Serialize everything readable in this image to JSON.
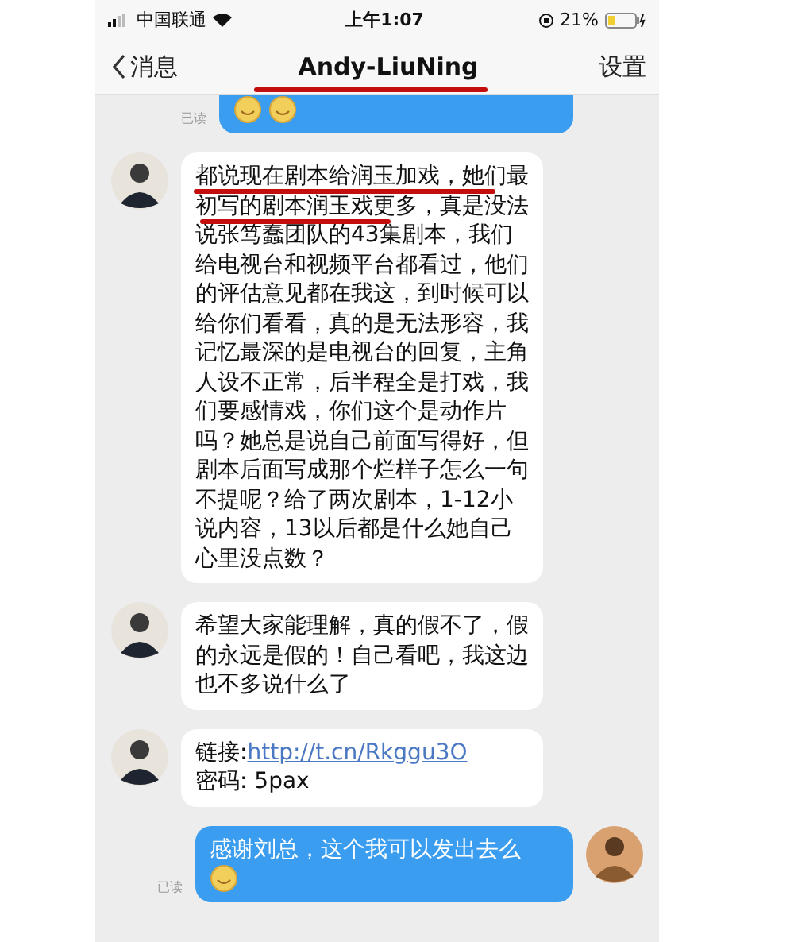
{
  "status_bar": {
    "carrier": "中国联通",
    "time": "上午1:07",
    "battery": "21%"
  },
  "nav": {
    "back": "消息",
    "title": "Andy-LiuNing",
    "title_underlined": true,
    "settings": "设置"
  },
  "messages": [
    {
      "kind": "sent_emoji",
      "read": "已读"
    },
    {
      "kind": "received",
      "text": "都说现在剧本给润玉加戏，她们最初写的剧本润玉戏更多，真是没法说张笃蠢团队的43集剧本，我们给电视台和视频平台都看过，他们的评估意见都在我这，到时候可以给你们看看，真的是无法形容，我记忆最深的是电视台的回复，主角人设不正常，后半程全是打戏，我们要感情戏，你们这个是动作片吗？她总是说自己前面写得好，但剧本后面写成那个烂样子怎么一句不提呢？给了两次剧本，1-12小说内容，13以后都是什么她自己心里没点数？",
      "underlined": true
    },
    {
      "kind": "received",
      "text": "希望大家能理解，真的假不了，假的永远是假的！自己看吧，我这边也不多说什么了",
      "underlined": false
    },
    {
      "kind": "received_link",
      "prefix": "链接:",
      "link": "http://t.cn/Rkggu3O",
      "suffix": "密码: 5pax"
    },
    {
      "kind": "sent",
      "text": "感谢刘总，这个我可以发出去么",
      "read": "已读"
    }
  ]
}
